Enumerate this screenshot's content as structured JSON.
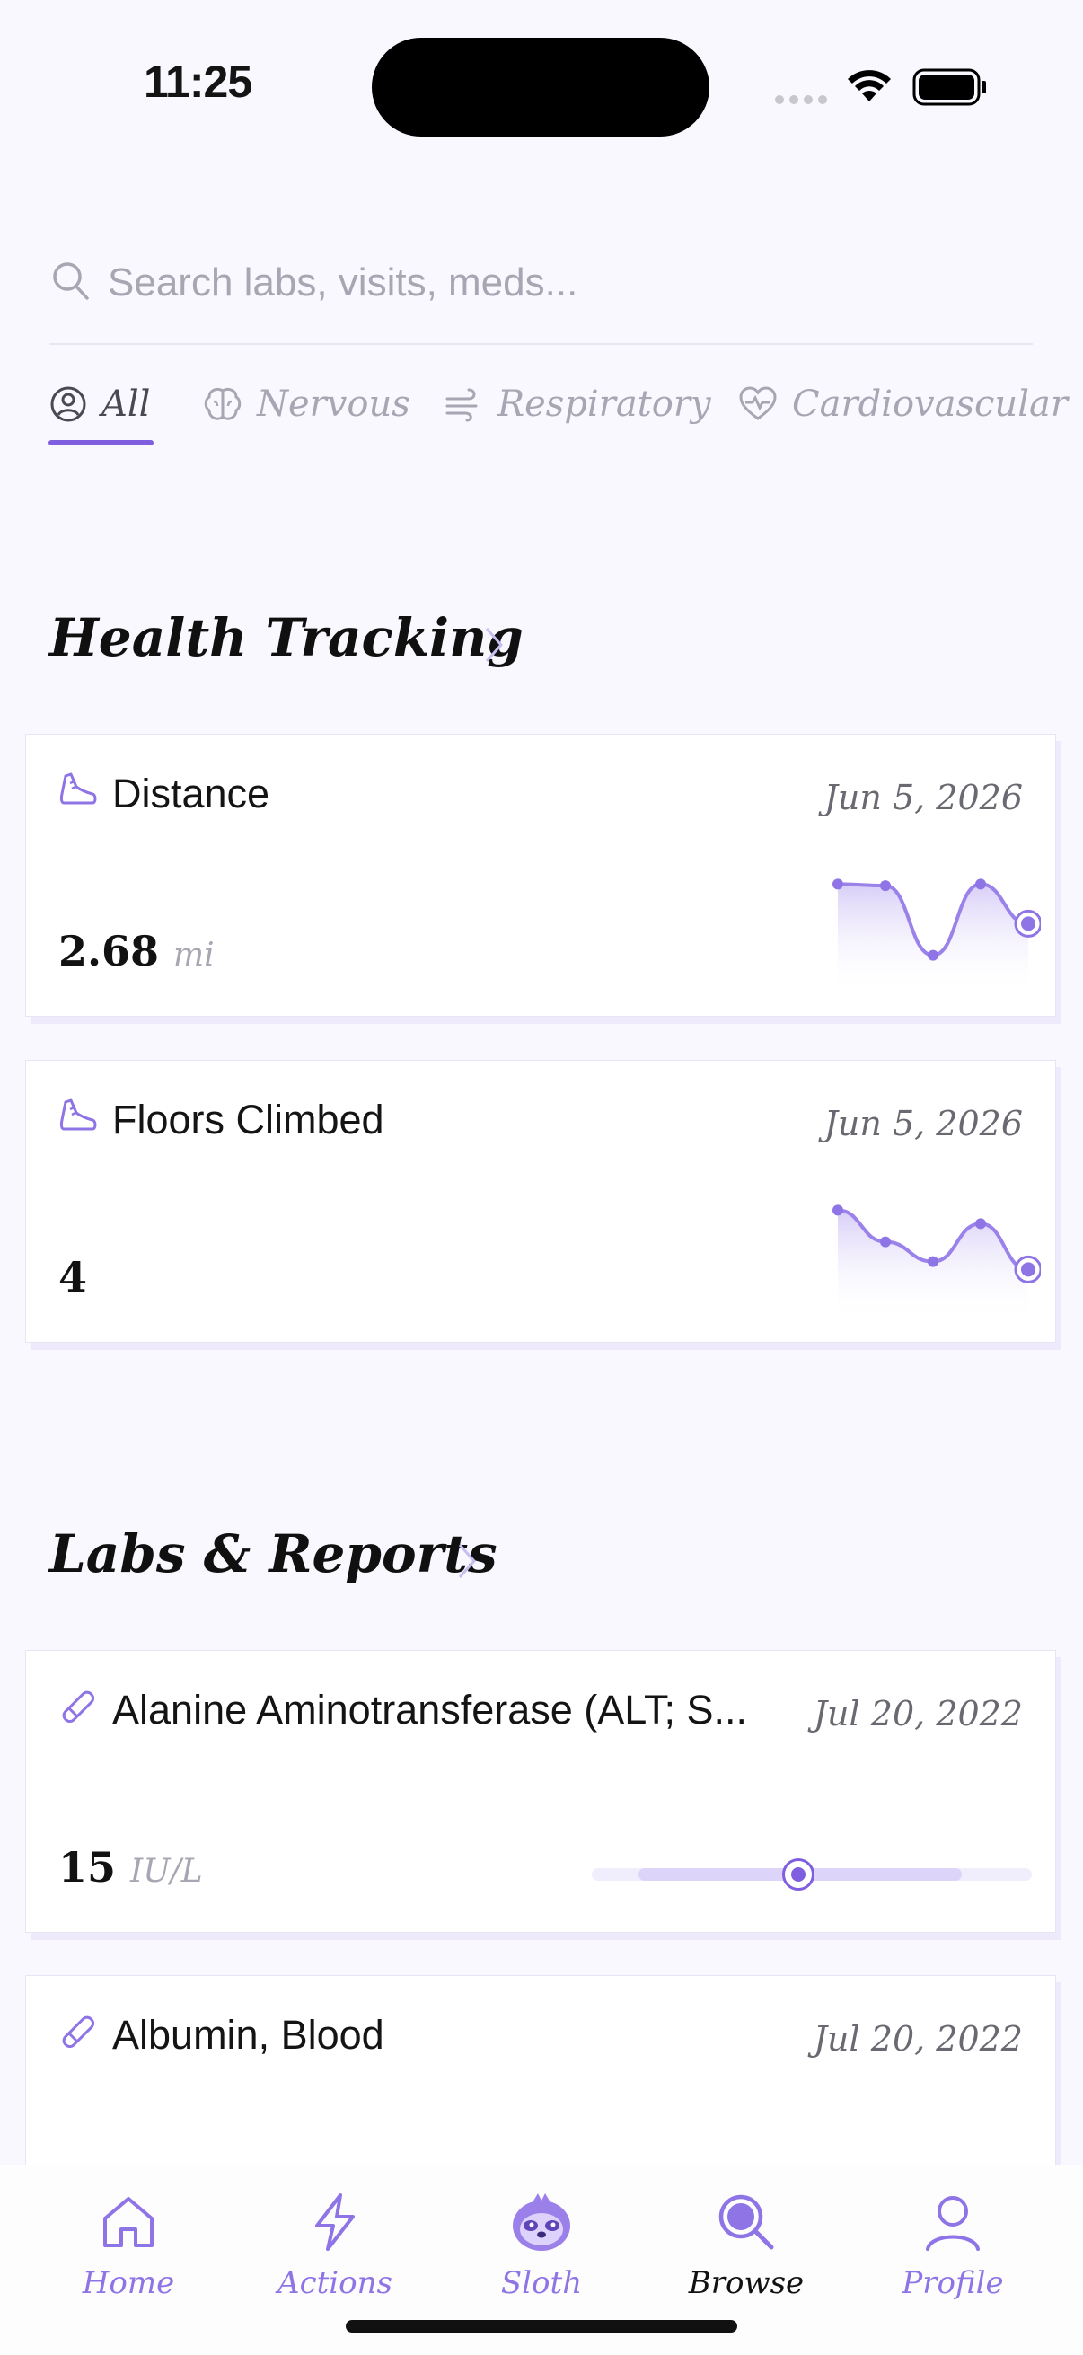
{
  "status": {
    "time": "11:25"
  },
  "search": {
    "placeholder": "Search labs, visits, meds..."
  },
  "tabs": [
    {
      "label": "All",
      "icon": "user-circle-icon",
      "active": true
    },
    {
      "label": "Nervous",
      "icon": "brain-icon"
    },
    {
      "label": "Respiratory",
      "icon": "wind-icon"
    },
    {
      "label": "Cardiovascular",
      "icon": "heart-pulse-icon"
    }
  ],
  "health": {
    "title": "Health Tracking",
    "cards": [
      {
        "title": "Distance",
        "date": "Jun 5, 2026",
        "value": "2.68",
        "unit": "mi",
        "icon": "sneaker-icon",
        "trend": [
          0.95,
          0.93,
          0.05,
          0.95,
          0.45
        ]
      },
      {
        "title": "Floors Climbed",
        "date": "Jun 5, 2026",
        "value": "4",
        "unit": "",
        "icon": "sneaker-icon",
        "trend": [
          0.95,
          0.55,
          0.3,
          0.78,
          0.2
        ]
      }
    ]
  },
  "labs": {
    "title": "Labs & Reports",
    "cards": [
      {
        "title": "Alanine Aminotransferase (ALT; S...",
        "date": "Jul 20, 2022",
        "value": "15",
        "unit": "IU/L",
        "icon": "test-tube-icon",
        "range_position": 0.47
      },
      {
        "title": "Albumin, Blood",
        "date": "Jul 20, 2022",
        "icon": "test-tube-icon"
      }
    ]
  },
  "nav": [
    {
      "label": "Home",
      "icon": "home-icon"
    },
    {
      "label": "Actions",
      "icon": "lightning-icon"
    },
    {
      "label": "Sloth",
      "icon": "sloth-icon"
    },
    {
      "label": "Browse",
      "icon": "search-icon",
      "active": true
    },
    {
      "label": "Profile",
      "icon": "profile-icon"
    }
  ],
  "colors": {
    "accent": "#7f5fe0",
    "background": "#f9f8fe"
  }
}
